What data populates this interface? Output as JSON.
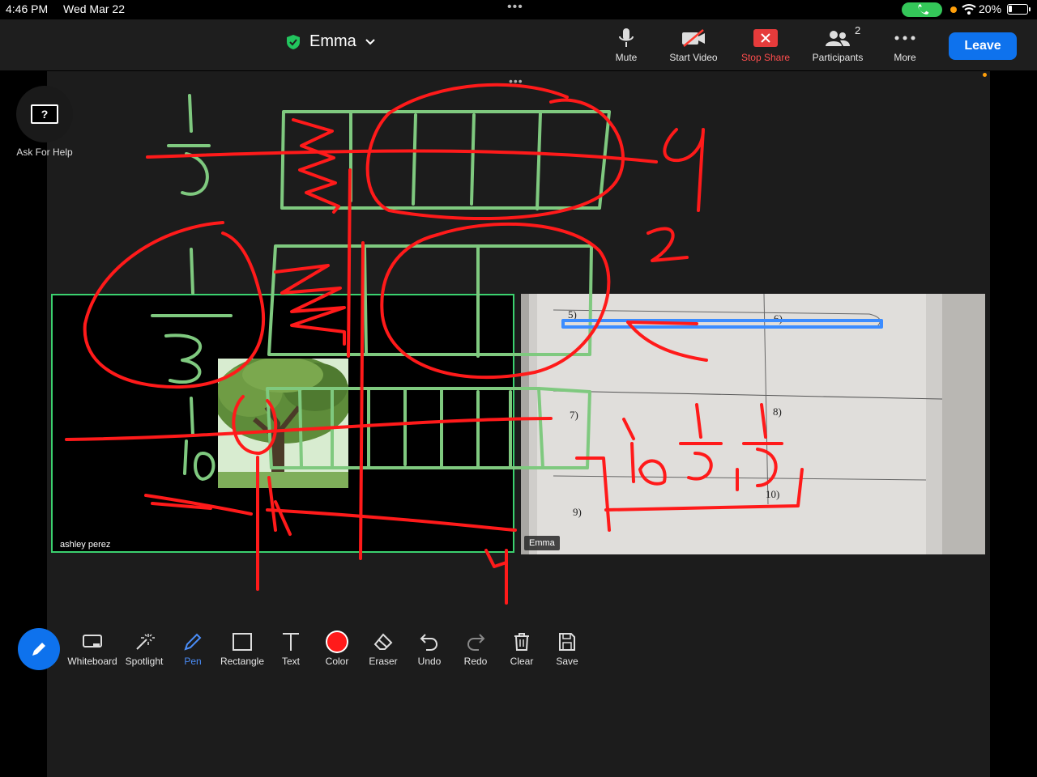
{
  "status_bar": {
    "time": "4:46 PM",
    "date": "Wed Mar 22",
    "battery": "20%"
  },
  "meeting": {
    "host_name": "Emma"
  },
  "toolbar": {
    "mute": "Mute",
    "start_video": "Start Video",
    "stop_share": "Stop Share",
    "participants": "Participants",
    "participants_count": "2",
    "more": "More",
    "leave": "Leave"
  },
  "help": {
    "label": "Ask For Help",
    "glyph": "?"
  },
  "tiles": {
    "left_name": "ashley perez",
    "right_name": "Emma"
  },
  "worksheet": {
    "q7": "7)",
    "q8": "8)",
    "q9": "9)",
    "q10": "10)",
    "q5": "5)",
    "q6": "6)"
  },
  "annotate_tools": [
    {
      "label": "Whiteboard",
      "icon": "whiteboard-icon"
    },
    {
      "label": "Spotlight",
      "icon": "spotlight-icon"
    },
    {
      "label": "Pen",
      "icon": "pen-icon"
    },
    {
      "label": "Rectangle",
      "icon": "rectangle-icon"
    },
    {
      "label": "Text",
      "icon": "text-icon"
    },
    {
      "label": "Color",
      "icon": "color-icon"
    },
    {
      "label": "Eraser",
      "icon": "eraser-icon"
    },
    {
      "label": "Undo",
      "icon": "undo-icon"
    },
    {
      "label": "Redo",
      "icon": "redo-icon"
    },
    {
      "label": "Clear",
      "icon": "trash-icon"
    },
    {
      "label": "Save",
      "icon": "save-icon"
    }
  ],
  "colors": {
    "accent": "#0e72ed",
    "ink_red": "#ff1a1a",
    "ink_green": "#7fc97f",
    "highlight_blue": "#3b8cff",
    "secure_green": "#22c55e"
  }
}
